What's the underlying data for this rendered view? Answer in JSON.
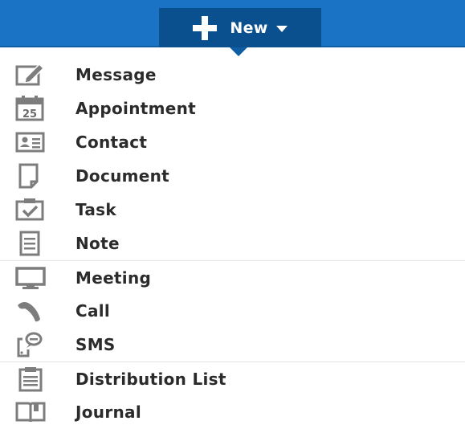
{
  "header": {
    "new_button_label": "New",
    "new_button_icon": "plus-icon",
    "dropdown_icon": "caret-down-icon",
    "bar_color": "#1a73c4",
    "button_color": "#0a4f8e"
  },
  "menu": {
    "items": [
      {
        "label": "Message",
        "icon": "compose-icon"
      },
      {
        "label": "Appointment",
        "icon": "calendar-icon",
        "icon_text": "25"
      },
      {
        "label": "Contact",
        "icon": "contact-card-icon"
      },
      {
        "label": "Document",
        "icon": "document-icon"
      },
      {
        "label": "Task",
        "icon": "task-icon"
      },
      {
        "label": "Note",
        "icon": "note-icon"
      },
      {
        "label": "Meeting",
        "icon": "monitor-icon"
      },
      {
        "label": "Call",
        "icon": "phone-icon"
      },
      {
        "label": "SMS",
        "icon": "sms-icon"
      },
      {
        "label": "Distribution List",
        "icon": "clipboard-list-icon"
      },
      {
        "label": "Journal",
        "icon": "book-icon"
      }
    ]
  }
}
